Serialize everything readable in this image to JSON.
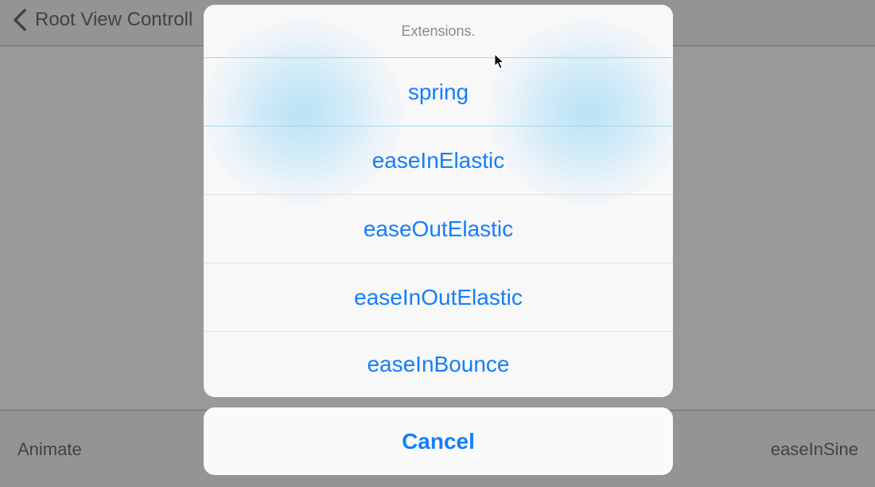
{
  "navbar": {
    "back_label": "Root View Controll"
  },
  "toolbar": {
    "left_label": "Animate",
    "right_label": "easeInSine"
  },
  "action_sheet": {
    "title": "Extensions.",
    "options": [
      {
        "label": "spring"
      },
      {
        "label": "easeInElastic"
      },
      {
        "label": "easeOutElastic"
      },
      {
        "label": "easeInOutElastic"
      },
      {
        "label": "easeInBounce"
      }
    ],
    "cancel_label": "Cancel"
  },
  "colors": {
    "accent": "#147efb",
    "dim_overlay": "rgba(0,0,0,0.40)"
  },
  "icons": {
    "back": "chevron-left-icon",
    "cursor": "mouse-pointer-icon"
  }
}
